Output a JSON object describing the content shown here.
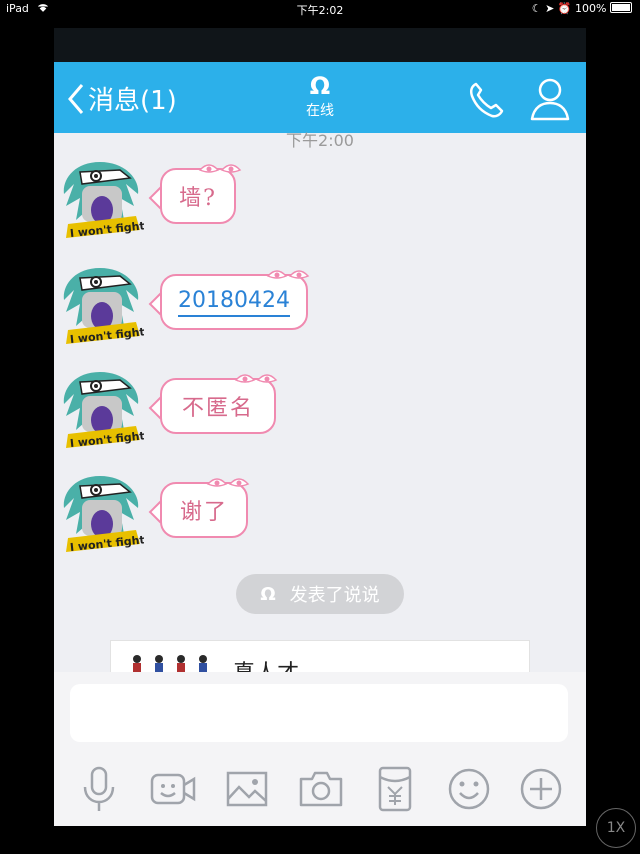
{
  "status_bar": {
    "device": "iPad",
    "time": "下午2:02",
    "battery": "100%"
  },
  "nav": {
    "back_label": "消息(1)",
    "contact_icon": "Ω",
    "contact_status": "在线"
  },
  "chat": {
    "timestamp": "下午2:00",
    "messages": [
      {
        "text": "墙?"
      },
      {
        "text": "20180424"
      },
      {
        "text": "不匿名"
      },
      {
        "text": "谢了"
      }
    ],
    "post_notice": {
      "icon": "Ω",
      "label": "发表了说说"
    },
    "shared_card": {
      "text": "真人才"
    },
    "avatar_caption": "I won't fight"
  },
  "toolbar": [
    "microphone-icon",
    "video-icon",
    "image-icon",
    "camera-icon",
    "red-envelope-icon",
    "emoji-icon",
    "plus-icon"
  ],
  "zoom_label": "1X",
  "colors": {
    "accent": "#2cb0ea",
    "bubble_border": "#f08ab0",
    "link": "#2a82d6"
  }
}
